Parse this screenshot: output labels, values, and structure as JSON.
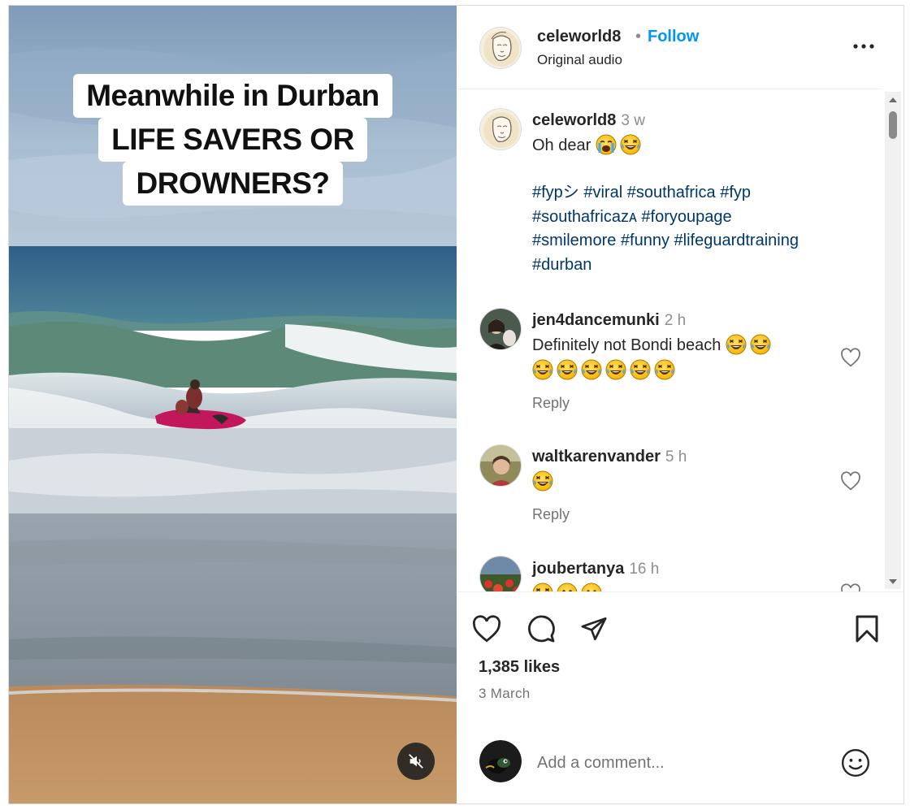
{
  "media": {
    "caption_lines": [
      "Meanwhile in Durban",
      "LIFE SAVERS OR",
      "DROWNERS?"
    ]
  },
  "header": {
    "username": "celeworld8",
    "separator": "•",
    "follow_label": "Follow",
    "audio_label": "Original audio"
  },
  "post_caption": {
    "username": "celeworld8",
    "time": "3 w",
    "text": "Oh dear",
    "emojis": [
      "crying-face",
      "laughing-face"
    ],
    "hashtag_lines": [
      "#fypシ #viral #southafrica #fyp",
      "#southafricaᴢᴀ #foryoupage",
      "#smilemore #funny #lifeguardtraining",
      "#durban"
    ]
  },
  "comments": [
    {
      "username": "jen4dancemunki",
      "time": "2 h",
      "text": "Definitely not Bondi beach",
      "emoji_line_1": 2,
      "emoji_line_2": 6,
      "reply_label": "Reply"
    },
    {
      "username": "waltkarenvander",
      "time": "5 h",
      "text": "",
      "emoji_line_1": 1,
      "reply_label": "Reply"
    },
    {
      "username": "joubertanya",
      "time": "16 h",
      "text": "",
      "emojis": [
        "laughing-face",
        "astonished-face",
        "frowning-face"
      ]
    }
  ],
  "actions": {
    "likes": "1,385 likes",
    "date": "3 March"
  },
  "add_comment": {
    "placeholder": "Add a comment..."
  },
  "colors": {
    "follow": "#0095f6",
    "hashtag": "#00376b",
    "muted_text": "#737373"
  },
  "icons": [
    "mute-icon",
    "more-icon",
    "heart-icon",
    "comment-icon",
    "share-icon",
    "bookmark-icon",
    "emoji-icon",
    "scroll-up-arrow",
    "scroll-down-arrow"
  ]
}
